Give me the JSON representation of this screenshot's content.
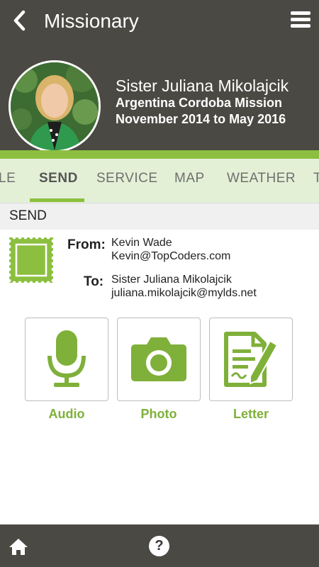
{
  "header": {
    "title": "Missionary",
    "back_icon": "chevron-left-icon",
    "menu_icon": "hamburger-menu-icon"
  },
  "profile": {
    "name": "Sister Juliana Mikolajcik",
    "mission": "Argentina Cordoba Mission",
    "dates": "November 2014 to May 2016"
  },
  "tabs": [
    {
      "label": "LE",
      "active": false
    },
    {
      "label": "SEND",
      "active": true
    },
    {
      "label": "SERVICE",
      "active": false
    },
    {
      "label": "MAP",
      "active": false
    },
    {
      "label": "WEATHER",
      "active": false
    },
    {
      "label": "T",
      "active": false
    }
  ],
  "section": {
    "title": "SEND"
  },
  "from": {
    "label": "From:",
    "name": "Kevin Wade",
    "email": "Kevin@TopCoders.com"
  },
  "to": {
    "label": "To:",
    "name": "Sister Juliana Mikolajcik",
    "email": "juliana.mikolajcik@mylds.net"
  },
  "actions": [
    {
      "label": "Audio",
      "icon": "microphone-icon"
    },
    {
      "label": "Photo",
      "icon": "camera-icon"
    },
    {
      "label": "Letter",
      "icon": "letter-pen-icon"
    }
  ],
  "footer": {
    "home_icon": "home-icon",
    "help_icon": "help-icon",
    "help_glyph": "?"
  },
  "colors": {
    "header_bg": "#4b4943",
    "accent_green": "#8cbf3f",
    "tab_bg": "#e3f0d6",
    "label_green": "#7fb03a"
  }
}
